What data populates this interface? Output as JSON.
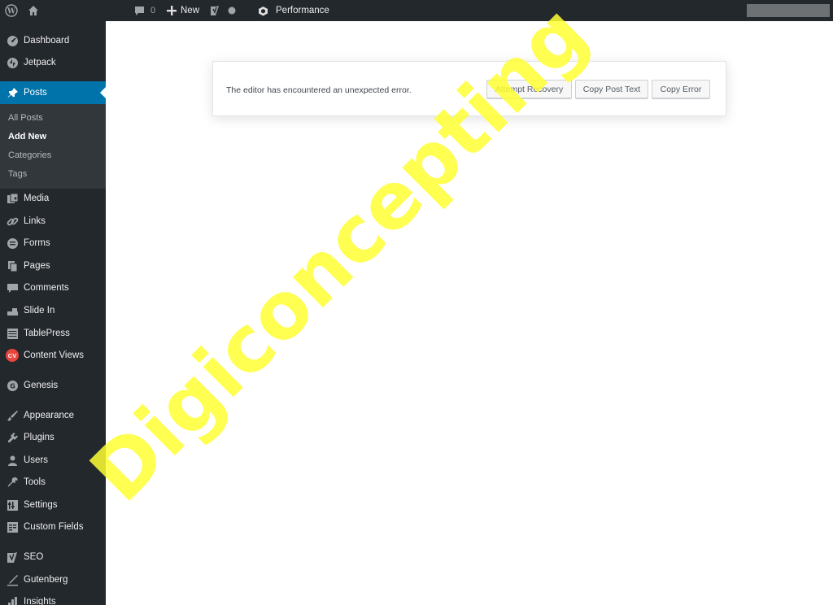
{
  "admin_bar": {
    "comments_count": "0",
    "new_label": "New",
    "performance_label": "Performance"
  },
  "sidebar": {
    "items": [
      {
        "label": "Dashboard",
        "icon": "dashboard-icon"
      },
      {
        "label": "Jetpack",
        "icon": "jetpack-icon"
      },
      {
        "label": "Posts",
        "icon": "pin-icon",
        "active": true
      },
      {
        "label": "Media",
        "icon": "media-icon"
      },
      {
        "label": "Links",
        "icon": "link-icon"
      },
      {
        "label": "Forms",
        "icon": "forms-icon"
      },
      {
        "label": "Pages",
        "icon": "pages-icon"
      },
      {
        "label": "Comments",
        "icon": "comment-icon"
      },
      {
        "label": "Slide In",
        "icon": "slide-in-icon"
      },
      {
        "label": "TablePress",
        "icon": "table-icon"
      },
      {
        "label": "Content Views",
        "icon": "cv-icon",
        "badge": "CV"
      },
      {
        "label": "Genesis",
        "icon": "genesis-icon"
      },
      {
        "label": "Appearance",
        "icon": "paintbrush-icon"
      },
      {
        "label": "Plugins",
        "icon": "plugin-icon"
      },
      {
        "label": "Users",
        "icon": "user-icon"
      },
      {
        "label": "Tools",
        "icon": "wrench-icon"
      },
      {
        "label": "Settings",
        "icon": "settings-icon"
      },
      {
        "label": "Custom Fields",
        "icon": "custom-fields-icon"
      },
      {
        "label": "SEO",
        "icon": "yoast-icon"
      },
      {
        "label": "Gutenberg",
        "icon": "gutenberg-icon"
      },
      {
        "label": "Insights",
        "icon": "insights-icon"
      }
    ],
    "posts_submenu": [
      {
        "label": "All Posts"
      },
      {
        "label": "Add New",
        "current": true
      },
      {
        "label": "Categories"
      },
      {
        "label": "Tags"
      }
    ]
  },
  "notice": {
    "message": "The editor has encountered an unexpected error.",
    "attempt_recovery": "Attempt Recovery",
    "copy_post_text": "Copy Post Text",
    "copy_error": "Copy Error"
  },
  "watermark": {
    "text": "Digiconcepting",
    "color": "#ffff33"
  },
  "colors": {
    "admin_dark": "#23282d",
    "submenu_bg": "#32373c",
    "active_blue": "#0073aa"
  }
}
